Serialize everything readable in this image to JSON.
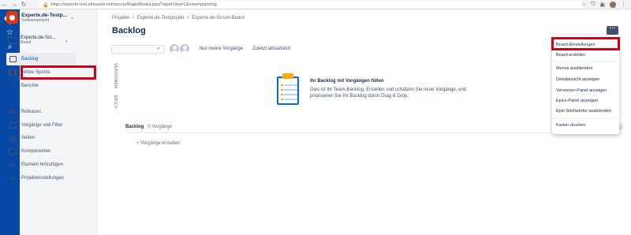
{
  "browser": {
    "url": "https://experte-test.atlassian.net/secure/RapidBoard.jspa?rapidView=1&view=planning"
  },
  "project": {
    "name": "Experte.de-Testp...",
    "type": "Softwareprojekt"
  },
  "board": {
    "name": "Experte.de-Scr...",
    "type": "Board"
  },
  "sidebar": {
    "items": [
      {
        "label": "Backlog",
        "icon": "backlog-icon"
      },
      {
        "label": "Aktive Sprints",
        "icon": "active-sprints-icon"
      },
      {
        "label": "Berichte",
        "icon": "reports-icon"
      },
      {
        "label": "Releases",
        "icon": "releases-icon"
      },
      {
        "label": "Vorgänge und Filter",
        "icon": "issues-filters-icon"
      },
      {
        "label": "Seiten",
        "icon": "pages-icon"
      },
      {
        "label": "Komponenten",
        "icon": "components-icon"
      },
      {
        "label": "Element hinzufügen",
        "icon": "add-item-icon"
      },
      {
        "label": "Projekteinstellungen",
        "icon": "project-settings-icon"
      }
    ]
  },
  "breadcrumb": [
    "Projekte",
    "Experte.de-Testprojekt",
    "Experte.de-Scrum-Board"
  ],
  "page": {
    "title": "Backlog"
  },
  "toolbar": {
    "search_value": "",
    "filter_only_mine": "Nur meine Vorgänge",
    "filter_recent": "Zuletzt aktualisiert"
  },
  "panels": {
    "versions": "VERSIONEN",
    "epics": "EPICS"
  },
  "empty_state": {
    "title": "Ihr Backlog mit Vorgängen füllen",
    "description": "Dies ist Ihr Team-Backlog. Erstellen und schätzen Sie neue Vorgänge, und priorisieren Sie Ihr Backlog durch Drag & Drop."
  },
  "backlog": {
    "label": "Backlog",
    "count": "0 Vorgänge",
    "create": "+ Vorgänge erstellen"
  },
  "menu": {
    "items": [
      "Board-Einstellungen",
      "Board erstellen",
      "Menüs ausblenden",
      "Detailansicht anzeigen",
      "Versionen-Panel anzeigen",
      "Epics-Panel anzeigen",
      "Epic-Stichwörter ausblenden",
      "Karten drucken"
    ]
  },
  "colors": {
    "global_nav": "#0747a6",
    "highlight": "#d0021b",
    "project_avatar": "#de350b"
  }
}
